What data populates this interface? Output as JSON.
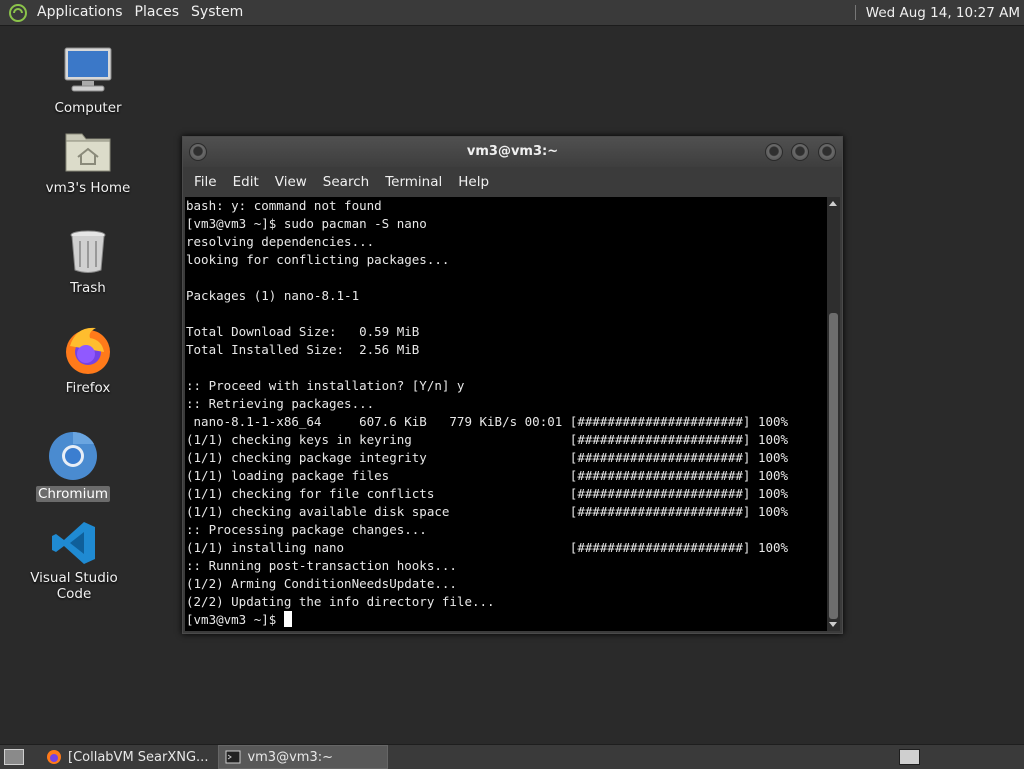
{
  "top_panel": {
    "menus": [
      "Applications",
      "Places",
      "System"
    ],
    "clock": "Wed Aug 14, 10:27 AM"
  },
  "desktop_icons": [
    {
      "label": "Computer",
      "icon": "computer-icon"
    },
    {
      "label": "vm3's Home",
      "icon": "home-folder-icon"
    },
    {
      "label": "Trash",
      "icon": "trash-icon"
    },
    {
      "label": "Firefox",
      "icon": "firefox-icon"
    },
    {
      "label": "Chromium",
      "icon": "chromium-icon",
      "selected": true
    },
    {
      "label": "Visual Studio Code",
      "icon": "vscode-icon"
    }
  ],
  "terminal": {
    "title": "vm3@vm3:~",
    "menu": [
      "File",
      "Edit",
      "View",
      "Search",
      "Terminal",
      "Help"
    ],
    "lines": [
      "bash: y: command not found",
      "[vm3@vm3 ~]$ sudo pacman -S nano",
      "resolving dependencies...",
      "looking for conflicting packages...",
      "",
      "Packages (1) nano-8.1-1",
      "",
      "Total Download Size:   0.59 MiB",
      "Total Installed Size:  2.56 MiB",
      "",
      ":: Proceed with installation? [Y/n] y",
      ":: Retrieving packages...",
      " nano-8.1-1-x86_64     607.6 KiB   779 KiB/s 00:01 [######################] 100%",
      "(1/1) checking keys in keyring                     [######################] 100%",
      "(1/1) checking package integrity                   [######################] 100%",
      "(1/1) loading package files                        [######################] 100%",
      "(1/1) checking for file conflicts                  [######################] 100%",
      "(1/1) checking available disk space                [######################] 100%",
      ":: Processing package changes...",
      "(1/1) installing nano                              [######################] 100%",
      ":: Running post-transaction hooks...",
      "(1/2) Arming ConditionNeedsUpdate...",
      "(2/2) Updating the info directory file...",
      "[vm3@vm3 ~]$ "
    ]
  },
  "taskbar": {
    "tasks": [
      {
        "label": "[CollabVM SearXNG...",
        "icon": "firefox-icon",
        "active": false
      },
      {
        "label": "vm3@vm3:~",
        "icon": "terminal-icon",
        "active": true
      }
    ]
  },
  "colors": {
    "panel": "#3a3a3a",
    "desktop": "#2a2a2a",
    "terminal_bg": "#000000",
    "terminal_fg": "#e8e8e8",
    "vscode_blue": "#1f8ad2",
    "firefox_orange": "#ff7a1a"
  }
}
